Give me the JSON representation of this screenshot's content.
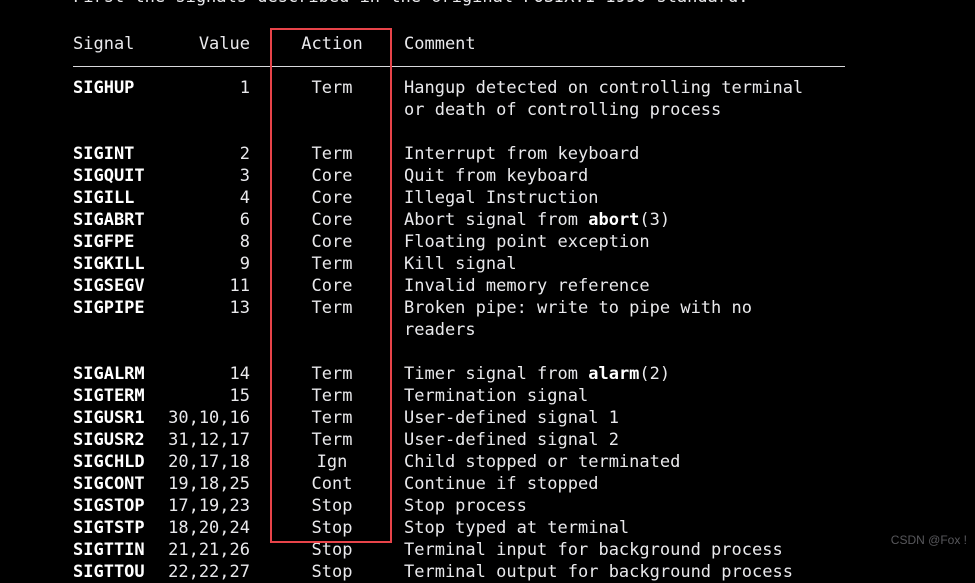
{
  "intro": {
    "text": "First the signals described in the original POSIX.1-1990 standard."
  },
  "colors": {
    "background": "#000000",
    "text": "#e9e9ec",
    "bold_text": "#ffffff",
    "rule": "#d8d8dc",
    "annotation_red": "#e8444a",
    "watermark": "#58585c"
  },
  "table": {
    "headers": {
      "signal": "Signal",
      "value": "Value",
      "action": "Action",
      "comment": "Comment"
    },
    "rows": [
      {
        "signal": "SIGHUP",
        "value": "1",
        "action": "Term",
        "comment": "Hangup detected on controlling terminal",
        "comment_cont": "or death of controlling process",
        "blank_after": true
      },
      {
        "signal": "SIGINT",
        "value": "2",
        "action": "Term",
        "comment": "Interrupt from keyboard"
      },
      {
        "signal": "SIGQUIT",
        "value": "3",
        "action": "Core",
        "comment": "Quit from keyboard"
      },
      {
        "signal": "SIGILL",
        "value": "4",
        "action": "Core",
        "comment": "Illegal Instruction"
      },
      {
        "signal": "SIGABRT",
        "value": "6",
        "action": "Core",
        "comment_pre": "Abort signal from ",
        "comment_bold": "abort",
        "comment_post": "(3)"
      },
      {
        "signal": "SIGFPE",
        "value": "8",
        "action": "Core",
        "comment": "Floating point exception"
      },
      {
        "signal": "SIGKILL",
        "value": "9",
        "action": "Term",
        "comment": "Kill signal"
      },
      {
        "signal": "SIGSEGV",
        "value": "11",
        "action": "Core",
        "comment": "Invalid memory reference"
      },
      {
        "signal": "SIGPIPE",
        "value": "13",
        "action": "Term",
        "comment": "Broken pipe: write to pipe with no",
        "comment_cont": "readers",
        "blank_after": true
      },
      {
        "signal": "SIGALRM",
        "value": "14",
        "action": "Term",
        "comment_pre": "Timer signal from ",
        "comment_bold": "alarm",
        "comment_post": "(2)"
      },
      {
        "signal": "SIGTERM",
        "value": "15",
        "action": "Term",
        "comment": "Termination signal"
      },
      {
        "signal": "SIGUSR1",
        "value": "30,10,16",
        "action": "Term",
        "comment": "User-defined signal 1"
      },
      {
        "signal": "SIGUSR2",
        "value": "31,12,17",
        "action": "Term",
        "comment": "User-defined signal 2"
      },
      {
        "signal": "SIGCHLD",
        "value": "20,17,18",
        "action": "Ign",
        "comment": "Child stopped or terminated"
      },
      {
        "signal": "SIGCONT",
        "value": "19,18,25",
        "action": "Cont",
        "comment": "Continue if stopped"
      },
      {
        "signal": "SIGSTOP",
        "value": "17,19,23",
        "action": "Stop",
        "comment": "Stop process"
      },
      {
        "signal": "SIGTSTP",
        "value": "18,20,24",
        "action": "Stop",
        "comment": "Stop typed at terminal"
      },
      {
        "signal": "SIGTTIN",
        "value": "21,21,26",
        "action": "Stop",
        "comment": "Terminal input for background process"
      },
      {
        "signal": "SIGTTOU",
        "value": "22,22,27",
        "action": "Stop",
        "comment": "Terminal output for background process"
      }
    ]
  },
  "annotation": {
    "target_column": "Action"
  },
  "watermark": {
    "text": "CSDN @Fox !"
  }
}
